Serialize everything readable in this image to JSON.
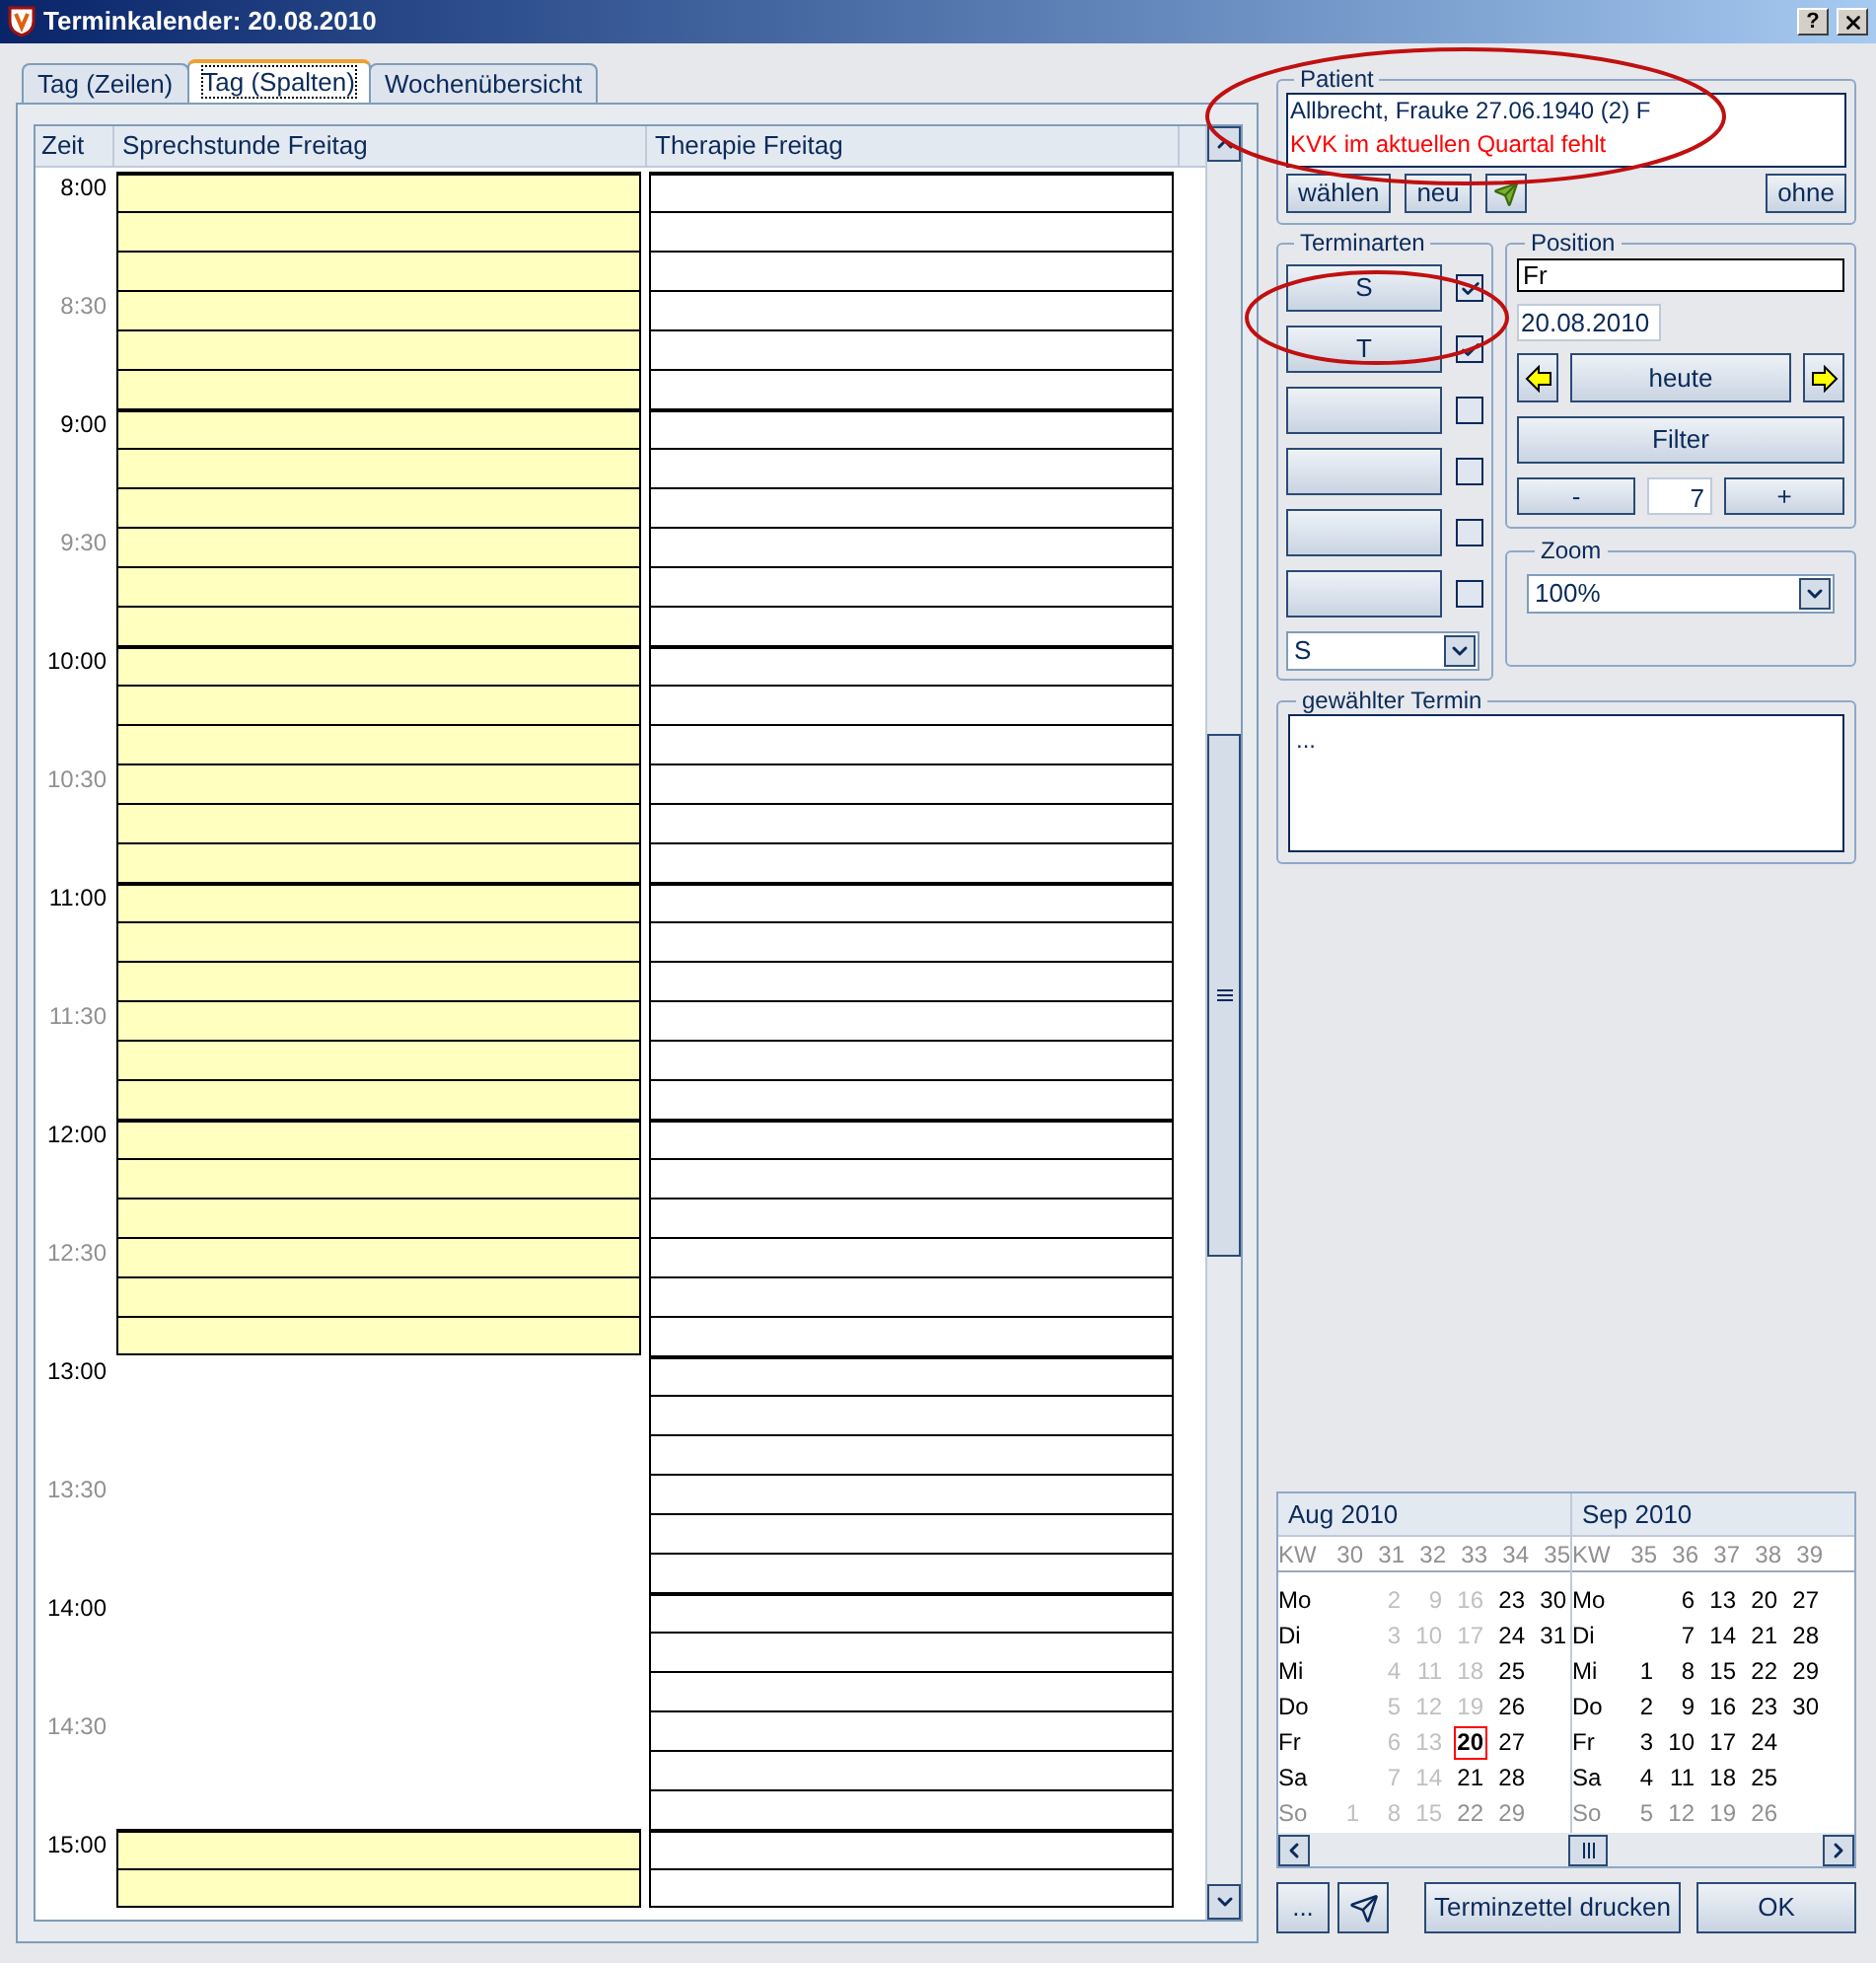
{
  "window": {
    "title": "Terminkalender: 20.08.2010",
    "help_button": "?"
  },
  "tabs": [
    {
      "label": "Tag (Zeilen)",
      "selected": false
    },
    {
      "label": "Tag (Spalten)",
      "selected": true
    },
    {
      "label": "Wochenübersicht",
      "selected": false
    }
  ],
  "schedule": {
    "time_header": "Zeit",
    "time_labels": [
      {
        "text": "8:00",
        "kind": "hour"
      },
      {
        "text": "8:30",
        "kind": "half"
      },
      {
        "text": "9:00",
        "kind": "hour"
      },
      {
        "text": "9:30",
        "kind": "half"
      },
      {
        "text": "10:00",
        "kind": "hour"
      },
      {
        "text": "10:30",
        "kind": "half"
      },
      {
        "text": "11:00",
        "kind": "hour"
      },
      {
        "text": "11:30",
        "kind": "half"
      },
      {
        "text": "12:00",
        "kind": "hour"
      },
      {
        "text": "12:30",
        "kind": "half"
      },
      {
        "text": "13:00",
        "kind": "hour"
      },
      {
        "text": "13:30",
        "kind": "half"
      },
      {
        "text": "14:00",
        "kind": "hour"
      },
      {
        "text": "14:30",
        "kind": "half"
      },
      {
        "text": "15:00",
        "kind": "hour"
      }
    ],
    "columns": [
      {
        "title": "Sprechstunde Freitag",
        "color": "#ffffc0",
        "slots": [
          {
            "kind": "open"
          },
          {
            "kind": "open"
          },
          {
            "kind": "open"
          },
          {
            "kind": "open"
          },
          {
            "kind": "open"
          },
          {
            "kind": "open"
          },
          {
            "kind": "open"
          },
          {
            "kind": "open"
          },
          {
            "kind": "open"
          },
          {
            "kind": "open"
          },
          {
            "kind": "open"
          },
          {
            "kind": "open"
          },
          {
            "kind": "open"
          },
          {
            "kind": "open"
          },
          {
            "kind": "open"
          },
          {
            "kind": "open"
          },
          {
            "kind": "open"
          },
          {
            "kind": "open"
          },
          {
            "kind": "open"
          },
          {
            "kind": "open"
          },
          {
            "kind": "open"
          },
          {
            "kind": "open"
          },
          {
            "kind": "open"
          },
          {
            "kind": "open"
          },
          {
            "kind": "open"
          },
          {
            "kind": "open"
          },
          {
            "kind": "open"
          },
          {
            "kind": "open"
          },
          {
            "kind": "open"
          },
          {
            "kind": "open"
          },
          {
            "kind": "closed"
          },
          {
            "kind": "closed"
          },
          {
            "kind": "closed"
          },
          {
            "kind": "closed"
          },
          {
            "kind": "closed"
          },
          {
            "kind": "closed"
          },
          {
            "kind": "closed"
          },
          {
            "kind": "closed"
          },
          {
            "kind": "closed"
          },
          {
            "kind": "closed"
          },
          {
            "kind": "closed"
          },
          {
            "kind": "closed"
          },
          {
            "kind": "open"
          },
          {
            "kind": "open"
          }
        ]
      },
      {
        "title": "Therapie Freitag",
        "color": "#ffffff",
        "slots": [
          {
            "kind": "open"
          },
          {
            "kind": "open"
          },
          {
            "kind": "open"
          },
          {
            "kind": "open"
          },
          {
            "kind": "open"
          },
          {
            "kind": "open"
          },
          {
            "kind": "open"
          },
          {
            "kind": "open"
          },
          {
            "kind": "open"
          },
          {
            "kind": "open"
          },
          {
            "kind": "open"
          },
          {
            "kind": "open"
          },
          {
            "kind": "open"
          },
          {
            "kind": "open"
          },
          {
            "kind": "open"
          },
          {
            "kind": "open"
          },
          {
            "kind": "open"
          },
          {
            "kind": "open"
          },
          {
            "kind": "open"
          },
          {
            "kind": "open"
          },
          {
            "kind": "open"
          },
          {
            "kind": "open"
          },
          {
            "kind": "open"
          },
          {
            "kind": "open"
          },
          {
            "kind": "open"
          },
          {
            "kind": "open"
          },
          {
            "kind": "open"
          },
          {
            "kind": "open"
          },
          {
            "kind": "open"
          },
          {
            "kind": "open"
          },
          {
            "kind": "open"
          },
          {
            "kind": "open"
          },
          {
            "kind": "open"
          },
          {
            "kind": "open"
          },
          {
            "kind": "open"
          },
          {
            "kind": "open"
          },
          {
            "kind": "open"
          },
          {
            "kind": "open"
          },
          {
            "kind": "open"
          },
          {
            "kind": "open"
          },
          {
            "kind": "open"
          },
          {
            "kind": "open"
          },
          {
            "kind": "open"
          },
          {
            "kind": "open"
          }
        ]
      }
    ]
  },
  "patient": {
    "legend": "Patient",
    "name": "Allbrecht, Frauke 27.06.1940 (2) F",
    "warning": "KVK im aktuellen Quartal fehlt",
    "buttons": [
      "wählen",
      "neu"
    ],
    "clear_button": "ohne"
  },
  "appointment_types": {
    "legend": "Terminarten",
    "items": [
      {
        "label": "S",
        "checked": true
      },
      {
        "label": "T",
        "checked": true
      },
      {
        "checked": false
      },
      {
        "checked": false
      },
      {
        "checked": false
      },
      {
        "checked": false
      }
    ],
    "select": "S"
  },
  "position": {
    "legend": "Position",
    "day": "Fr",
    "date": "20.08.2010",
    "today_button": "heute",
    "filter_button": "Filter",
    "minus_button": "-",
    "count": "7",
    "plus_button": "+"
  },
  "zoom": {
    "legend": "Zoom",
    "value": "100%"
  },
  "selected_appointment": {
    "legend": "gewählter Termin",
    "text": "..."
  },
  "calendar": {
    "months": [
      {
        "title": "Aug 2010",
        "kw_label": "KW",
        "weeks": [
          "30",
          "31",
          "32",
          "33",
          "34",
          "35"
        ],
        "rows": [
          {
            "day": "Mo",
            "kind": "weekday",
            "cells": [
              null,
              {
                "text": "2",
                "kind": "past"
              },
              {
                "text": "9",
                "kind": "past"
              },
              {
                "text": "16",
                "kind": "past"
              },
              {
                "text": "23",
                "kind": "day"
              },
              {
                "text": "30",
                "kind": "day"
              }
            ]
          },
          {
            "day": "Di",
            "kind": "weekday",
            "cells": [
              null,
              {
                "text": "3",
                "kind": "past"
              },
              {
                "text": "10",
                "kind": "past"
              },
              {
                "text": "17",
                "kind": "past"
              },
              {
                "text": "24",
                "kind": "day"
              },
              {
                "text": "31",
                "kind": "day"
              }
            ]
          },
          {
            "day": "Mi",
            "kind": "weekday",
            "cells": [
              null,
              {
                "text": "4",
                "kind": "past"
              },
              {
                "text": "11",
                "kind": "past"
              },
              {
                "text": "18",
                "kind": "past"
              },
              {
                "text": "25",
                "kind": "day"
              },
              null
            ]
          },
          {
            "day": "Do",
            "kind": "weekday",
            "cells": [
              null,
              {
                "text": "5",
                "kind": "past"
              },
              {
                "text": "12",
                "kind": "past"
              },
              {
                "text": "19",
                "kind": "past"
              },
              {
                "text": "26",
                "kind": "day"
              },
              null
            ]
          },
          {
            "day": "Fr",
            "kind": "weekday",
            "cells": [
              null,
              {
                "text": "6",
                "kind": "past"
              },
              {
                "text": "13",
                "kind": "past"
              },
              {
                "text": "20",
                "kind": "selected"
              },
              {
                "text": "27",
                "kind": "day"
              },
              null
            ]
          },
          {
            "day": "Sa",
            "kind": "weekday",
            "cells": [
              null,
              {
                "text": "7",
                "kind": "past"
              },
              {
                "text": "14",
                "kind": "past"
              },
              {
                "text": "21",
                "kind": "day"
              },
              {
                "text": "28",
                "kind": "day"
              },
              null
            ]
          },
          {
            "day": "So",
            "kind": "sunday",
            "cells": [
              {
                "text": "1",
                "kind": "past"
              },
              {
                "text": "8",
                "kind": "past"
              },
              {
                "text": "15",
                "kind": "past"
              },
              {
                "text": "22",
                "kind": "sunday"
              },
              {
                "text": "29",
                "kind": "sunday"
              },
              null
            ]
          }
        ]
      },
      {
        "title": "Sep 2010",
        "kw_label": "KW",
        "weeks": [
          "35",
          "36",
          "37",
          "38",
          "39"
        ],
        "rows": [
          {
            "day": "Mo",
            "kind": "weekday",
            "cells": [
              null,
              {
                "text": "6",
                "kind": "day"
              },
              {
                "text": "13",
                "kind": "day"
              },
              {
                "text": "20",
                "kind": "day"
              },
              {
                "text": "27",
                "kind": "day"
              }
            ]
          },
          {
            "day": "Di",
            "kind": "weekday",
            "cells": [
              null,
              {
                "text": "7",
                "kind": "day"
              },
              {
                "text": "14",
                "kind": "day"
              },
              {
                "text": "21",
                "kind": "day"
              },
              {
                "text": "28",
                "kind": "day"
              }
            ]
          },
          {
            "day": "Mi",
            "kind": "weekday",
            "cells": [
              {
                "text": "1",
                "kind": "day"
              },
              {
                "text": "8",
                "kind": "day"
              },
              {
                "text": "15",
                "kind": "day"
              },
              {
                "text": "22",
                "kind": "day"
              },
              {
                "text": "29",
                "kind": "day"
              }
            ]
          },
          {
            "day": "Do",
            "kind": "weekday",
            "cells": [
              {
                "text": "2",
                "kind": "day"
              },
              {
                "text": "9",
                "kind": "day"
              },
              {
                "text": "16",
                "kind": "day"
              },
              {
                "text": "23",
                "kind": "day"
              },
              {
                "text": "30",
                "kind": "day"
              }
            ]
          },
          {
            "day": "Fr",
            "kind": "weekday",
            "cells": [
              {
                "text": "3",
                "kind": "day"
              },
              {
                "text": "10",
                "kind": "day"
              },
              {
                "text": "17",
                "kind": "day"
              },
              {
                "text": "24",
                "kind": "day"
              },
              null
            ]
          },
          {
            "day": "Sa",
            "kind": "weekday",
            "cells": [
              {
                "text": "4",
                "kind": "day"
              },
              {
                "text": "11",
                "kind": "day"
              },
              {
                "text": "18",
                "kind": "day"
              },
              {
                "text": "25",
                "kind": "day"
              },
              null
            ]
          },
          {
            "day": "So",
            "kind": "sunday",
            "cells": [
              {
                "text": "5",
                "kind": "sunday"
              },
              {
                "text": "12",
                "kind": "sunday"
              },
              {
                "text": "19",
                "kind": "sunday"
              },
              {
                "text": "26",
                "kind": "sunday"
              },
              null
            ]
          }
        ]
      }
    ]
  },
  "footer": {
    "more_button": "...",
    "print_button": "Terminzettel drucken",
    "ok_button": "OK"
  }
}
